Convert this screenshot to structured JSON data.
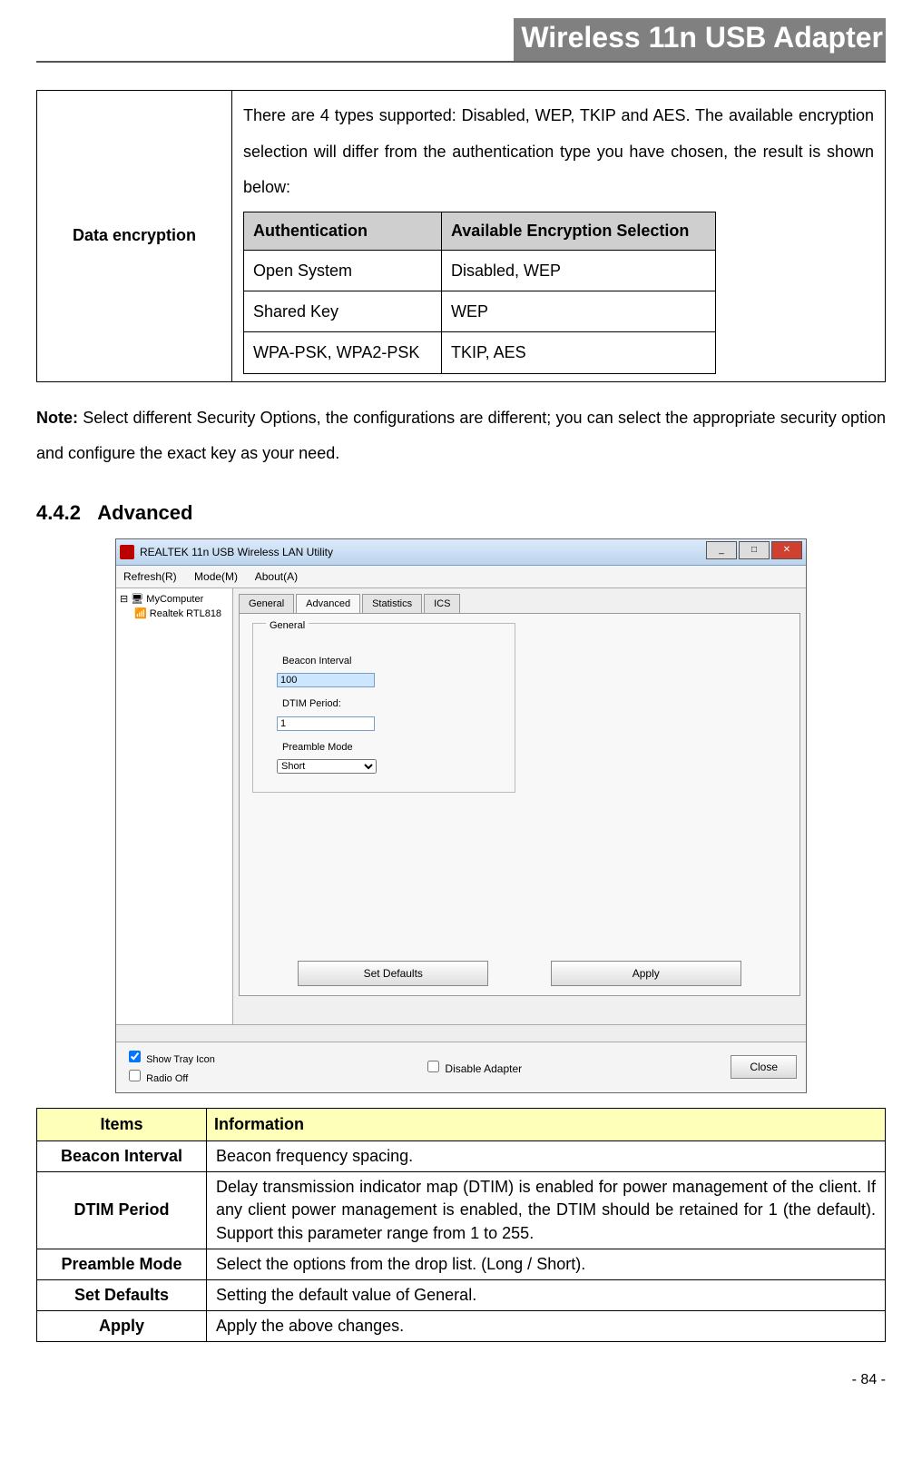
{
  "header": {
    "title": "Wireless 11n USB Adapter"
  },
  "encryption": {
    "label": "Data encryption",
    "intro": "There are 4 types supported: Disabled, WEP, TKIP and AES. The available encryption selection will differ from the authentication type you have chosen, the result is shown below:",
    "headers": {
      "auth": "Authentication",
      "enc": "Available Encryption Selection"
    },
    "rows": [
      {
        "auth": "Open System",
        "enc": "Disabled, WEP"
      },
      {
        "auth": "Shared Key",
        "enc": "WEP"
      },
      {
        "auth": "WPA-PSK, WPA2-PSK",
        "enc": "TKIP, AES"
      }
    ]
  },
  "note": {
    "prefix": "Note:",
    "body": " Select different Security Options, the configurations are different; you can select the appropriate security option and configure the exact key as your need."
  },
  "section": {
    "number": "4.4.2",
    "title": "Advanced"
  },
  "screenshot": {
    "window_title": "REALTEK 11n USB Wireless LAN Utility",
    "menus": {
      "refresh": "Refresh(R)",
      "mode": "Mode(M)",
      "about": "About(A)"
    },
    "tree": {
      "root": "MyComputer",
      "child": "Realtek RTL818"
    },
    "tabs": {
      "general": "General",
      "advanced": "Advanced",
      "statistics": "Statistics",
      "ics": "ICS"
    },
    "group": "General",
    "fields": {
      "beacon_label": "Beacon Interval",
      "beacon_value": "100",
      "dtim_label": "DTIM Period:",
      "dtim_value": "1",
      "preamble_label": "Preamble Mode",
      "preamble_value": "Short"
    },
    "buttons": {
      "set_defaults": "Set Defaults",
      "apply": "Apply",
      "close": "Close"
    },
    "checks": {
      "show_tray": "Show Tray Icon",
      "radio_off": "Radio Off",
      "disable_adapter": "Disable Adapter"
    }
  },
  "items_table": {
    "headers": {
      "items": "Items",
      "info": "Information"
    },
    "rows": [
      {
        "item": "Beacon Interval",
        "info": "Beacon frequency spacing."
      },
      {
        "item": "DTIM Period",
        "info": "Delay transmission indicator map (DTIM) is enabled for power management of the client. If any client power management is enabled, the DTIM should be retained for 1 (the default). Support this parameter range from 1 to 255."
      },
      {
        "item": "Preamble Mode",
        "info": "Select the options from the drop list. (Long / Short)."
      },
      {
        "item": "Set Defaults",
        "info": "Setting the default value of General."
      },
      {
        "item": "Apply",
        "info": "Apply the above changes."
      }
    ]
  },
  "page": "- 84 -"
}
